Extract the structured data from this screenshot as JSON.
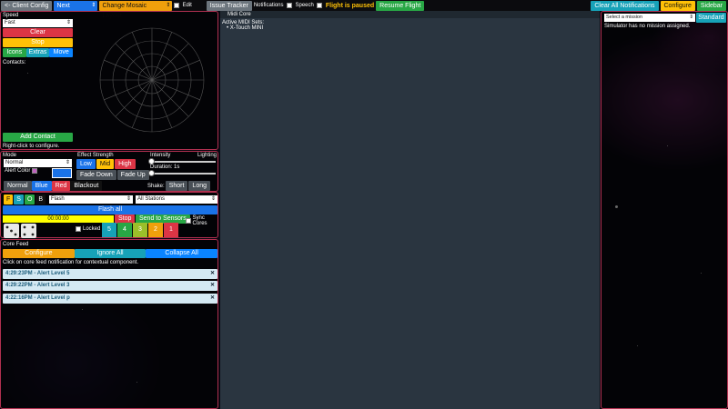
{
  "topbar": {
    "client_config": "<- Client Config",
    "next_select": "Next",
    "layout_select": "Change Mosaic Layout",
    "edit_label": "Edit",
    "issue_tracker": "Issue Tracker",
    "notifications_label": "Notifications",
    "speech_label": "Speech",
    "paused_text": "Flight is paused",
    "resume_flight": "Resume Flight",
    "clear_notifications": "Clear All Notifications",
    "configure": "Configure",
    "sidebar": "Sidebar"
  },
  "sensors": {
    "speed_title": "Speed",
    "speed_value": "Fast",
    "clear": "Clear",
    "stop": "Stop",
    "icons": "Icons",
    "extras": "Extras",
    "move": "Move",
    "contacts_label": "Contacts:",
    "add_contact": "Add Contact",
    "hint": "Right-click to configure."
  },
  "lighting": {
    "mode_title": "Mode",
    "mode_value": "Normal",
    "alert_color_label": "Alert Color",
    "effect_title": "Effect Strength",
    "low": "Low",
    "mid": "Mid",
    "high": "High",
    "fade_down": "Fade Down",
    "fade_up": "Fade Up",
    "intensity_title": "Intensity",
    "lighting_title": "Lighting",
    "duration": "Duration: 1s",
    "normal": "Normal",
    "blue": "Blue",
    "red": "Red",
    "blackout": "Blackout",
    "shake_label": "Shake:",
    "short": "Short",
    "long": "Long"
  },
  "stations": {
    "f": "F",
    "s": "S",
    "o": "O",
    "b": "B",
    "effect_value": "Flash",
    "stations_value": "All Stations",
    "flash_all": "Flash all",
    "timer": "00:00:00",
    "stop": "Stop",
    "send_to_sensors": "Send to Sensors",
    "sync_cores": "Sync Cores",
    "locked": "Locked",
    "numbers": [
      "5",
      "4",
      "3",
      "2",
      "1"
    ]
  },
  "corefeed": {
    "title": "Core Feed",
    "configure": "Configure",
    "ignore_all": "Ignore All",
    "collapse_all": "Collapse All",
    "hint": "Click on core feed notification for contextual component.",
    "items": [
      "4:29:23PM - Alert Level 5",
      "4:29:22PM - Alert Level 3",
      "4:22:16PM - Alert Level p"
    ]
  },
  "midi": {
    "title": "Midi Core",
    "sets_label": "Active MIDI Sets:",
    "sets": [
      "X-Touch MINI"
    ]
  },
  "mission": {
    "placeholder": "Select a mission",
    "standard": "Standard",
    "status": "Simulator has no mission assigned."
  },
  "colors": {
    "accent_blue": "#1a73e8",
    "danger": "#dc3545",
    "warning": "#ffc107",
    "success": "#28a745",
    "info": "#17a2b8",
    "panel_border": "#b03050"
  }
}
